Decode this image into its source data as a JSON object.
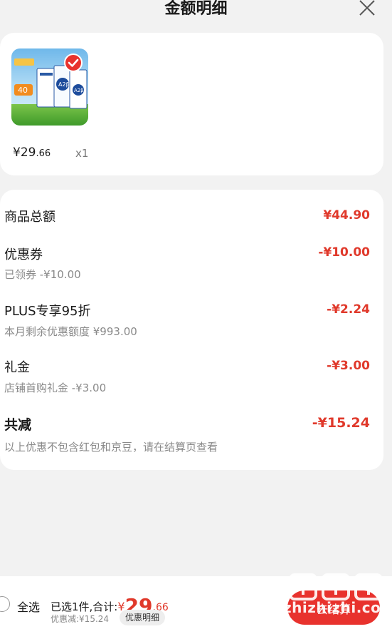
{
  "header": {
    "title": "金额明细",
    "close_icon": "close-icon"
  },
  "product": {
    "image_icon": "milk-product-image",
    "selected_icon": "check-icon",
    "price_symbol": "¥",
    "price_int": "29",
    "price_dec": ".66",
    "quantity": "x1"
  },
  "details": {
    "rows": [
      {
        "title": "商品总额",
        "value": "¥44.90",
        "sub": ""
      },
      {
        "title": "优惠券",
        "value": "-¥10.00",
        "sub": "已领券 -¥10.00"
      },
      {
        "title": "PLUS专享95折",
        "value": "-¥2.24",
        "sub": "本月剩余优惠额度 ¥993.00"
      },
      {
        "title": "礼金",
        "value": "-¥3.00",
        "sub": "店铺首购礼金 -¥3.00"
      }
    ],
    "total": {
      "title": "共减",
      "value": "-¥15.24",
      "sub": "以上优惠不包含红包和京豆，请在结算页查看"
    }
  },
  "footer": {
    "select_all": "全选",
    "summary_prefix": "已选1件,合计:",
    "summary_yen": "¥",
    "summary_int": "29",
    "summary_dec": ".66",
    "discount_text": "优惠减:¥15.24",
    "detail_button": "优惠明细",
    "checkout_label": "去结算"
  },
  "watermark": {
    "text": "zhizhizhi.com"
  },
  "colors": {
    "accent": "#e0392b",
    "background": "#f2f2f2",
    "card": "#ffffff"
  }
}
